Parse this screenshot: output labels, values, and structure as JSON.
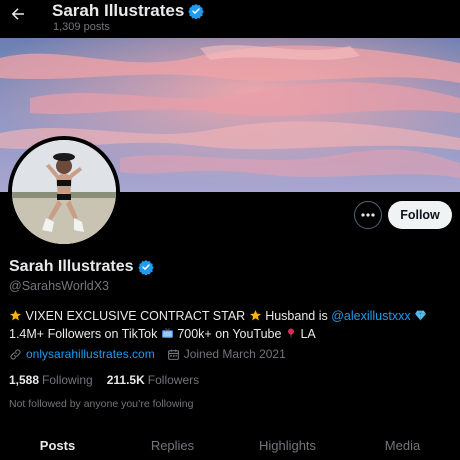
{
  "header": {
    "name": "Sarah Illustrates",
    "post_count": "1,309 posts"
  },
  "profile": {
    "name": "Sarah Illustrates",
    "handle": "@SarahsWorldX3",
    "bio": {
      "part1": "VIXEN EXCLUSIVE CONTRACT STAR",
      "part2": "Husband is",
      "mention": "@alexillustxxx",
      "part3": "1.4M+",
      "part4": "Followers on TikTok",
      "part5": "700k+ on YouTube",
      "part6": "LA"
    },
    "website": "onlysarahillustrates.com",
    "joined": "Joined March 2021",
    "following_count": "1,588",
    "following_label": "Following",
    "followers_count": "211.5K",
    "followers_label": "Followers",
    "not_followed": "Not followed by anyone you’re following"
  },
  "actions": {
    "more": "•••",
    "follow": "Follow"
  },
  "tabs": [
    "Posts",
    "Replies",
    "Highlights",
    "Media"
  ],
  "colors": {
    "accent": "#1d9bf0",
    "background": "#000000",
    "text": "#e7e9ea",
    "muted": "#71767b"
  }
}
